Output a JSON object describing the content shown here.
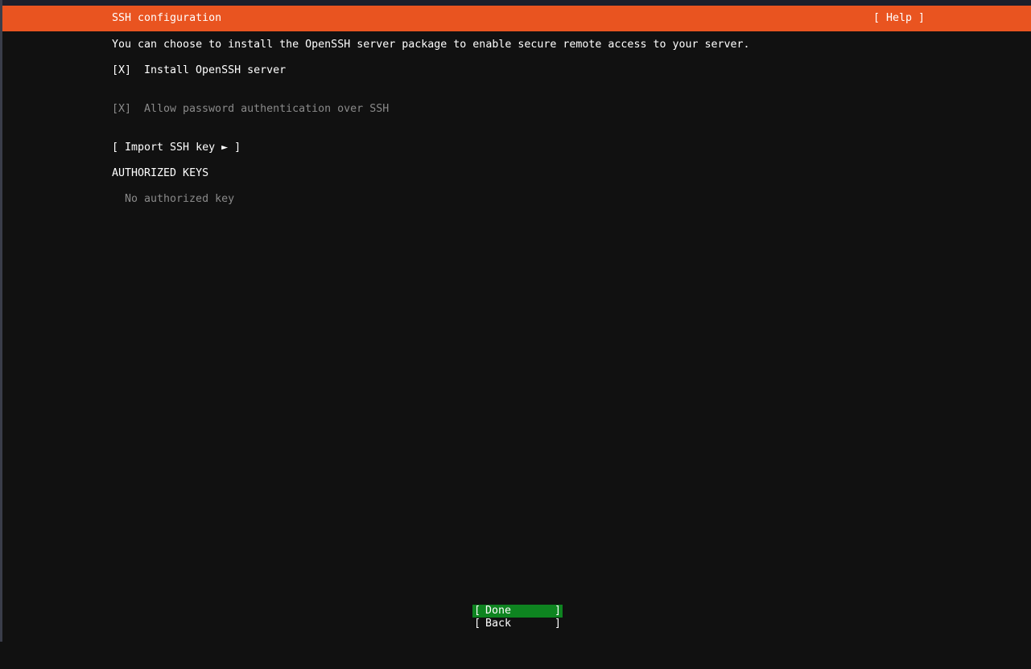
{
  "header": {
    "title": "SSH configuration",
    "help_label": "[ Help ]"
  },
  "description": "You can choose to install the OpenSSH server package to enable secure remote access to your server.",
  "options": [
    {
      "checkbox": "[X]",
      "label": "Install OpenSSH server",
      "enabled": true
    },
    {
      "checkbox": "[X]",
      "label": "Allow password authentication over SSH",
      "enabled": false
    }
  ],
  "import_button": "[ Import SSH key ► ]",
  "authorized_keys": {
    "heading": "AUTHORIZED KEYS",
    "empty_text": "No authorized key"
  },
  "buttons": {
    "done": "Done",
    "back": "Back",
    "open_bracket": "[",
    "close_bracket": "]"
  },
  "colors": {
    "header": "#e95420",
    "selected": "#0e8420"
  }
}
